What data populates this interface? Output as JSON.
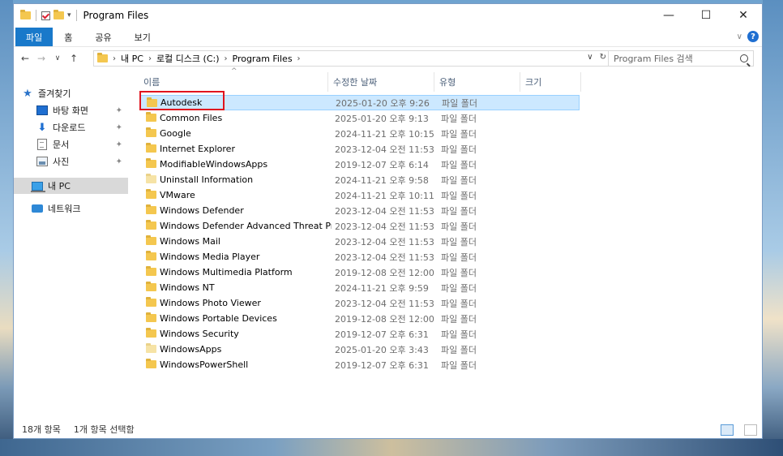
{
  "window": {
    "title": "Program Files"
  },
  "controls": {
    "minimize": "—",
    "maximize": "☐",
    "close": "✕"
  },
  "ribbon": {
    "tabs": [
      "파일",
      "홈",
      "공유",
      "보기"
    ]
  },
  "address": {
    "crumbs": [
      "내 PC",
      "로컬 디스크 (C:)",
      "Program Files"
    ],
    "search_placeholder": "Program Files 검색"
  },
  "nav_pane": {
    "quick_access": "즐겨찾기",
    "pinned": [
      "바탕 화면",
      "다운로드",
      "문서",
      "사진"
    ],
    "this_pc": "내 PC",
    "network": "네트워크"
  },
  "columns": [
    "이름",
    "수정한 날짜",
    "유형",
    "크기"
  ],
  "files": [
    {
      "name": "Autodesk",
      "date": "2025-01-20 오후 9:26",
      "type": "파일 폴더",
      "pale": false,
      "selected": true
    },
    {
      "name": "Common Files",
      "date": "2025-01-20 오후 9:13",
      "type": "파일 폴더",
      "pale": false
    },
    {
      "name": "Google",
      "date": "2024-11-21 오후 10:15",
      "type": "파일 폴더",
      "pale": false
    },
    {
      "name": "Internet Explorer",
      "date": "2023-12-04 오전 11:53",
      "type": "파일 폴더",
      "pale": false
    },
    {
      "name": "ModifiableWindowsApps",
      "date": "2019-12-07 오후 6:14",
      "type": "파일 폴더",
      "pale": false
    },
    {
      "name": "Uninstall Information",
      "date": "2024-11-21 오후 9:58",
      "type": "파일 폴더",
      "pale": true
    },
    {
      "name": "VMware",
      "date": "2024-11-21 오후 10:11",
      "type": "파일 폴더",
      "pale": false
    },
    {
      "name": "Windows Defender",
      "date": "2023-12-04 오전 11:53",
      "type": "파일 폴더",
      "pale": false
    },
    {
      "name": "Windows Defender Advanced Threat Pr...",
      "date": "2023-12-04 오전 11:53",
      "type": "파일 폴더",
      "pale": false
    },
    {
      "name": "Windows Mail",
      "date": "2023-12-04 오전 11:53",
      "type": "파일 폴더",
      "pale": false
    },
    {
      "name": "Windows Media Player",
      "date": "2023-12-04 오전 11:53",
      "type": "파일 폴더",
      "pale": false
    },
    {
      "name": "Windows Multimedia Platform",
      "date": "2019-12-08 오전 12:00",
      "type": "파일 폴더",
      "pale": false
    },
    {
      "name": "Windows NT",
      "date": "2024-11-21 오후 9:59",
      "type": "파일 폴더",
      "pale": false
    },
    {
      "name": "Windows Photo Viewer",
      "date": "2023-12-04 오전 11:53",
      "type": "파일 폴더",
      "pale": false
    },
    {
      "name": "Windows Portable Devices",
      "date": "2019-12-08 오전 12:00",
      "type": "파일 폴더",
      "pale": false
    },
    {
      "name": "Windows Security",
      "date": "2019-12-07 오후 6:31",
      "type": "파일 폴더",
      "pale": false
    },
    {
      "name": "WindowsApps",
      "date": "2025-01-20 오후 3:43",
      "type": "파일 폴더",
      "pale": true
    },
    {
      "name": "WindowsPowerShell",
      "date": "2019-12-07 오후 6:31",
      "type": "파일 폴더",
      "pale": false
    }
  ],
  "status": {
    "count": "18개 항목",
    "selected": "1개 항목 선택함"
  },
  "colors": {
    "accent": "#1979ca",
    "selection": "#cce8ff",
    "highlight": "#e0141e",
    "folder": "#f4c74f"
  }
}
